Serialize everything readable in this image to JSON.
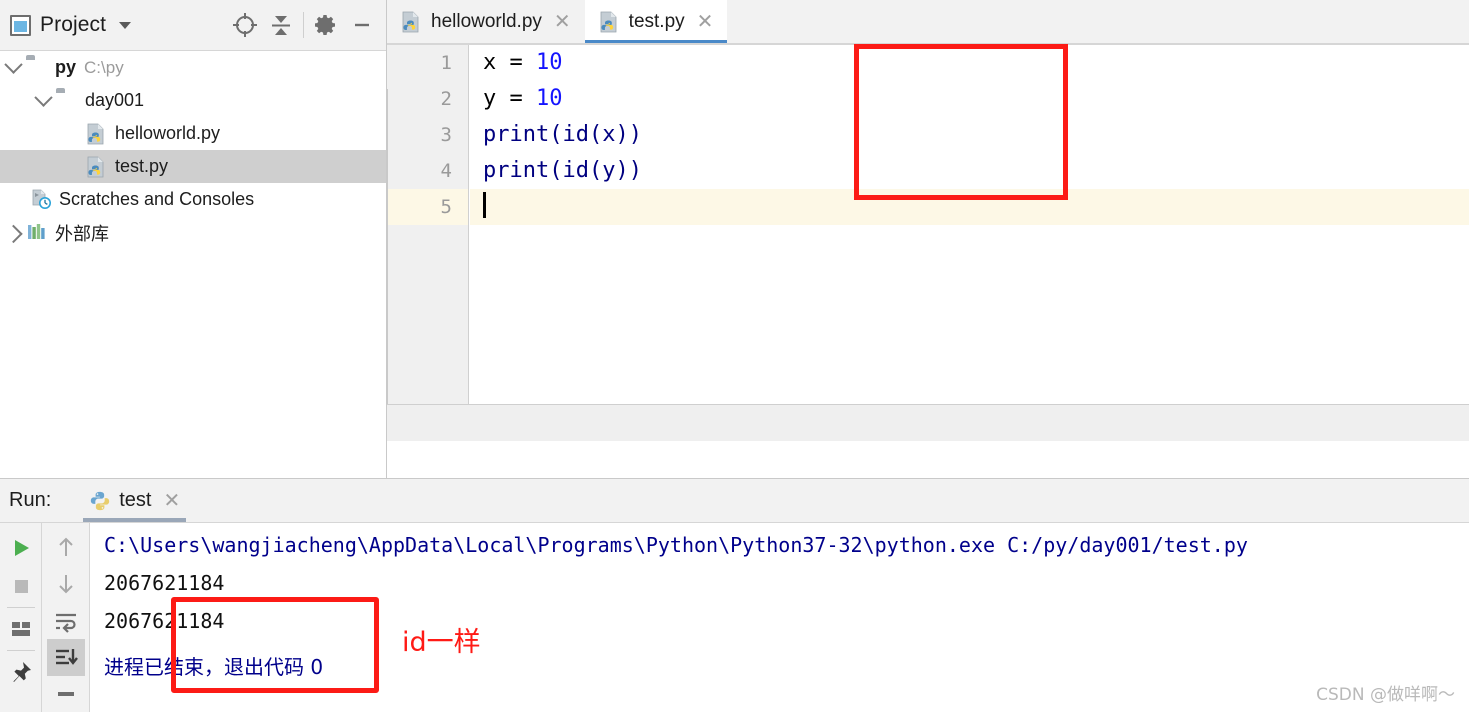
{
  "project_panel": {
    "title": "Project",
    "window_icon": "project-window-icon",
    "dropdown_icon": "chevron-down-icon",
    "tools": [
      {
        "name": "locate-target-icon",
        "glyph": "target"
      },
      {
        "name": "collapse-all-icon",
        "glyph": "collapse"
      },
      {
        "name": "settings-gear-icon",
        "glyph": "gear"
      },
      {
        "name": "hide-panel-icon",
        "glyph": "minus"
      }
    ],
    "tree": [
      {
        "label": "py",
        "secondary": "C:\\py",
        "icon": "folder-icon",
        "expand": "expanded",
        "indent": 0,
        "bold": true,
        "selected": false
      },
      {
        "label": "day001",
        "secondary": "",
        "icon": "folder-module-icon",
        "expand": "expanded",
        "indent": 1,
        "bold": false,
        "selected": false
      },
      {
        "label": "helloworld.py",
        "secondary": "",
        "icon": "python-file-icon",
        "expand": "none",
        "indent": 2,
        "bold": false,
        "selected": false
      },
      {
        "label": "test.py",
        "secondary": "",
        "icon": "python-file-icon",
        "expand": "none",
        "indent": 2,
        "bold": false,
        "selected": true
      },
      {
        "label": "Scratches and Consoles",
        "secondary": "",
        "icon": "scratches-icon",
        "expand": "none",
        "indent": 1,
        "bold": false,
        "selected": false
      },
      {
        "label": "外部库",
        "secondary": "",
        "icon": "external-libraries-icon",
        "expand": "collapsed",
        "indent": 0,
        "bold": false,
        "selected": false
      }
    ]
  },
  "editor": {
    "tabs": [
      {
        "label": "helloworld.py",
        "icon": "python-file-icon",
        "close_icon": "close-icon",
        "active": false
      },
      {
        "label": "test.py",
        "icon": "python-file-icon",
        "close_icon": "close-icon",
        "active": true
      }
    ],
    "gutter": [
      "1",
      "2",
      "3",
      "4",
      "5"
    ],
    "lines": [
      {
        "n": "1",
        "tokens": [
          {
            "t": "x = ",
            "c": "plain"
          },
          {
            "t": "10",
            "c": "number"
          }
        ]
      },
      {
        "n": "2",
        "tokens": [
          {
            "t": "y = ",
            "c": "plain"
          },
          {
            "t": "10",
            "c": "number"
          }
        ]
      },
      {
        "n": "3",
        "tokens": [
          {
            "t": "print(id(x))",
            "c": "func"
          }
        ]
      },
      {
        "n": "4",
        "tokens": [
          {
            "t": "print(id(y))",
            "c": "func"
          }
        ]
      },
      {
        "n": "5",
        "tokens": [
          {
            "t": "",
            "c": "caret"
          }
        ]
      }
    ],
    "current_line": 5,
    "annotation_box_color": "#fc1b16"
  },
  "run_panel": {
    "label": "Run:",
    "tab_label": "test",
    "tab_icon": "python-icon",
    "tab_close_icon": "close-icon",
    "left_buttons": [
      {
        "name": "rerun-button",
        "glyph": "play"
      },
      {
        "name": "stop-button",
        "glyph": "stop"
      },
      {
        "name": "layout-button",
        "glyph": "layout"
      },
      {
        "name": "pin-tab-button",
        "glyph": "pin"
      }
    ],
    "right_buttons": [
      {
        "name": "scroll-up-button",
        "glyph": "arrow-up"
      },
      {
        "name": "scroll-down-button",
        "glyph": "arrow-down"
      },
      {
        "name": "soft-wrap-button",
        "glyph": "wrap"
      },
      {
        "name": "scroll-to-end-button",
        "glyph": "scroll-end"
      },
      {
        "name": "print-button",
        "glyph": "bar"
      }
    ],
    "console": {
      "command": "C:\\Users\\wangjiacheng\\AppData\\Local\\Programs\\Python\\Python37-32\\python.exe C:/py/day001/test.py",
      "output": [
        "2067621184",
        "2067621184"
      ],
      "exit_message": "进程已结束，退出代码 0"
    },
    "annotation_note": "id一样",
    "annotation_color": "#ff1a15"
  },
  "watermark": "CSDN @做咩啊～"
}
